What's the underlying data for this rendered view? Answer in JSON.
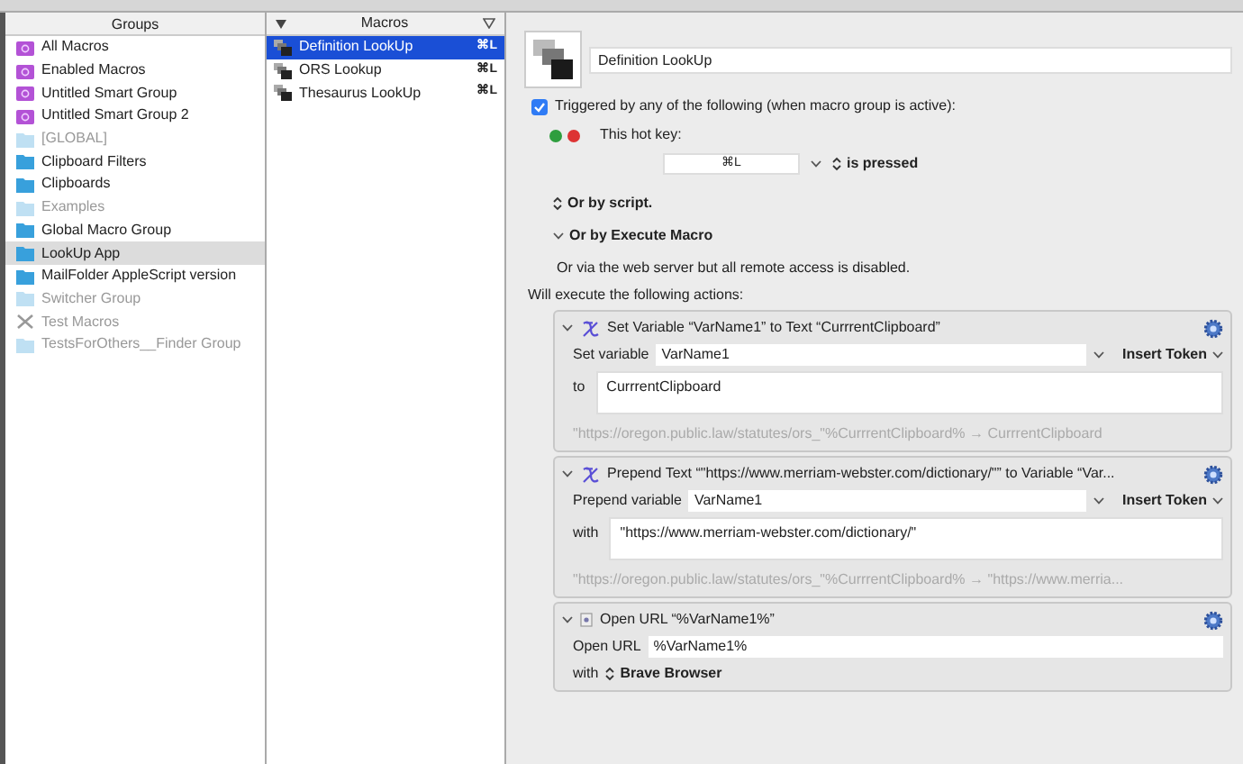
{
  "groups": {
    "header": "Groups",
    "items": [
      {
        "label": "All Macros",
        "kind": "smart",
        "disabled": false,
        "selected": false
      },
      {
        "label": "Enabled Macros",
        "kind": "smart",
        "disabled": false,
        "selected": false
      },
      {
        "label": "Untitled Smart Group",
        "kind": "smart",
        "disabled": false,
        "selected": false
      },
      {
        "label": "Untitled Smart Group 2",
        "kind": "smart",
        "disabled": false,
        "selected": false
      },
      {
        "label": "[GLOBAL]",
        "kind": "folder",
        "disabled": true,
        "selected": false
      },
      {
        "label": "Clipboard Filters",
        "kind": "folder",
        "disabled": false,
        "selected": false
      },
      {
        "label": "Clipboards",
        "kind": "folder",
        "disabled": false,
        "selected": false
      },
      {
        "label": "Examples",
        "kind": "folder",
        "disabled": true,
        "selected": false
      },
      {
        "label": "Global Macro Group",
        "kind": "folder",
        "disabled": false,
        "selected": false
      },
      {
        "label": "LookUp App",
        "kind": "folder",
        "disabled": false,
        "selected": true
      },
      {
        "label": "MailFolder AppleScript version",
        "kind": "folder",
        "disabled": false,
        "selected": false
      },
      {
        "label": "Switcher Group",
        "kind": "folder",
        "disabled": true,
        "selected": false
      },
      {
        "label": "Test Macros",
        "kind": "tools",
        "disabled": true,
        "selected": false
      },
      {
        "label": "TestsForOthers__Finder Group",
        "kind": "folder",
        "disabled": true,
        "selected": false
      }
    ]
  },
  "macros": {
    "header": "Macros",
    "items": [
      {
        "label": "Definition LookUp",
        "shortcut": "⌘L",
        "selected": true
      },
      {
        "label": "ORS Lookup",
        "shortcut": "⌘L",
        "selected": false
      },
      {
        "label": "Thesaurus LookUp",
        "shortcut": "⌘L",
        "selected": false
      }
    ]
  },
  "editor": {
    "macro_name": "Definition LookUp",
    "triggered": {
      "label": "Triggered by any of the following (when macro group is active):",
      "checked": true
    },
    "hot_key_label": "This hot key:",
    "hot_key": "⌘L",
    "key_state": "is pressed",
    "or_script": "Or by script.",
    "or_execute": "Or by Execute Macro",
    "web_server": "Or via the web server but all remote access is disabled.",
    "will_execute": "Will execute the following actions:",
    "actions": [
      {
        "kind": "variable",
        "title": "Set Variable “VarName1” to Text “CurrrentClipboard”",
        "field_label": "Set variable",
        "field_value": "VarName1",
        "token": "Insert Token",
        "text_label": "to",
        "text_value": "CurrrentClipboard",
        "preview": "\"https://oregon.public.law/statutes/ors_\"%CurrrentClipboard% → CurrrentClipboard"
      },
      {
        "kind": "variable",
        "title": "Prepend Text “\"https://www.merriam-webster.com/dictionary/\"” to Variable “Var...",
        "field_label": "Prepend variable",
        "field_value": "VarName1",
        "token": "Insert Token",
        "text_label": "with",
        "text_value": "\"https://www.merriam-webster.com/dictionary/\"",
        "preview": "\"https://oregon.public.law/statutes/ors_\"%CurrrentClipboard% → \"https://www.merria..."
      },
      {
        "kind": "url",
        "title": "Open URL “%VarName1%”",
        "field_label": "Open URL",
        "field_value": "%VarName1%",
        "with_label": "with",
        "browser": "Brave Browser"
      }
    ]
  }
}
